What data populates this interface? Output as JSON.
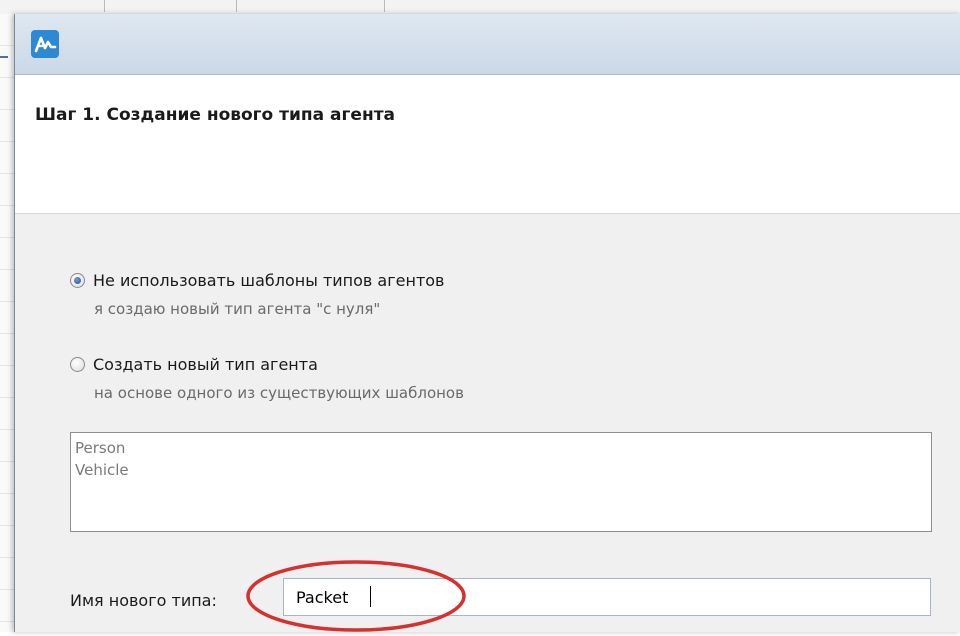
{
  "icons": {
    "app_icon": "anylogic-logo-icon",
    "radio_selected": "radio-selected-icon",
    "radio_unselected": "radio-unselected-icon"
  },
  "colors": {
    "titlebar": "#cbd8e6",
    "app_icon_bg": "#2d8ad2",
    "highlight": "#d6302f",
    "content_bg": "#f0f0f0"
  },
  "wizard": {
    "title": "Шаг 1. Создание нового типа агента"
  },
  "options": [
    {
      "label": "Не использовать шаблоны типов агентов",
      "description": "я создаю новый тип агента \"с нуля\"",
      "selected": true
    },
    {
      "label": "Создать новый тип агента",
      "description": "на основе одного из существующих шаблонов",
      "selected": false
    }
  ],
  "templates": [
    "Person",
    "Vehicle"
  ],
  "new_type": {
    "label": "Имя нового типа:",
    "value": "Packet"
  }
}
